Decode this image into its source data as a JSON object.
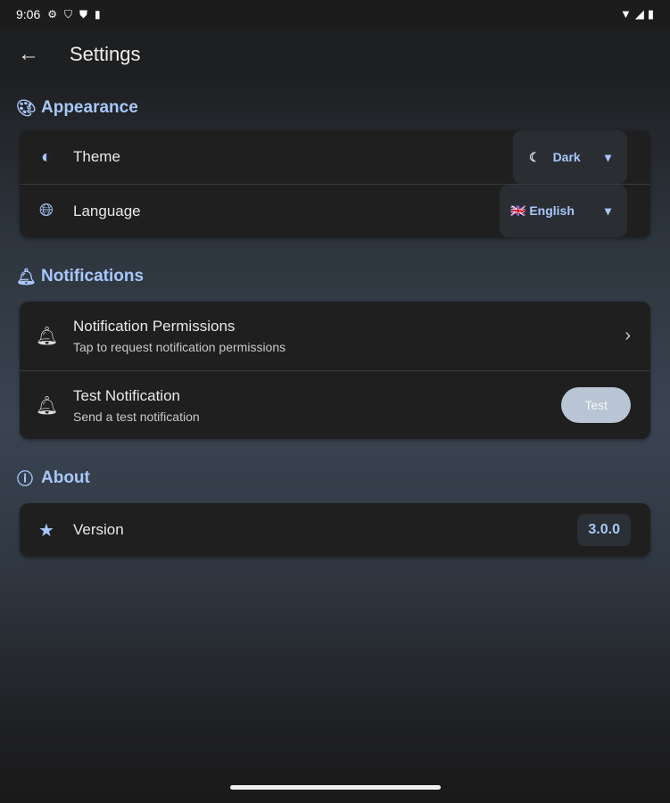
{
  "status_bar": {
    "time": "9:06"
  },
  "app_bar": {
    "title": "Settings"
  },
  "sections": {
    "appearance": {
      "title": "Appearance",
      "theme_label": "Theme",
      "theme_value": "Dark",
      "language_label": "Language",
      "language_value": "🇬🇧 English"
    },
    "notifications": {
      "title": "Notifications",
      "perm_label": "Notification Permissions",
      "perm_sub": "Tap to request notification permissions",
      "test_label": "Test Notification",
      "test_sub": "Send a test notification",
      "test_button": "Test"
    },
    "about": {
      "title": "About",
      "version_label": "Version",
      "version_value": "3.0.0"
    }
  },
  "colors": {
    "accent": "#a8c7fa",
    "card": "#1f1f1f"
  }
}
